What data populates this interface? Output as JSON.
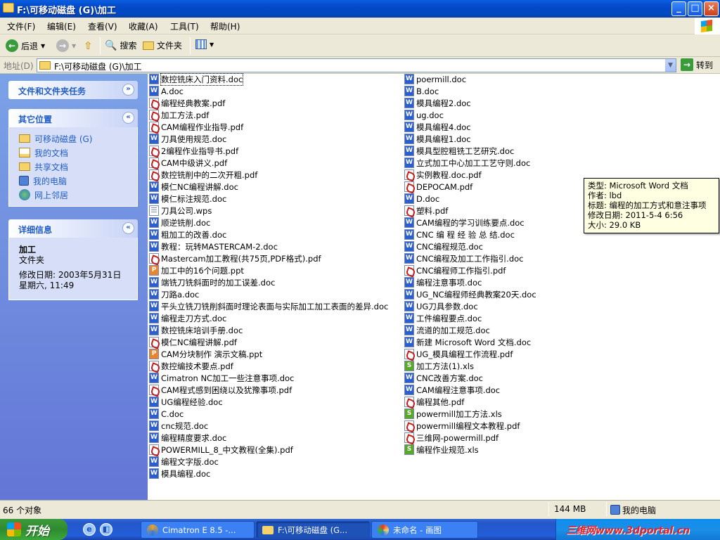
{
  "window": {
    "title": "F:\\可移动磁盘 (G)\\加工"
  },
  "menu": [
    "文件(F)",
    "编辑(E)",
    "查看(V)",
    "收藏(A)",
    "工具(T)",
    "帮助(H)"
  ],
  "toolbar": {
    "back": "后退",
    "search": "搜索",
    "folders": "文件夹"
  },
  "address": {
    "label": "地址(D)",
    "value": "F:\\可移动磁盘 (G)\\加工",
    "go": "转到"
  },
  "left": {
    "tasks_title": "文件和文件夹任务",
    "places_title": "其它位置",
    "places": [
      "可移动磁盘 (G)",
      "我的文档",
      "共享文档",
      "我的电脑",
      "网上邻居"
    ],
    "details_title": "详细信息",
    "details": {
      "name": "加工",
      "type": "文件夹",
      "modified_label": "修改日期:",
      "modified_date": "2003年5月31日",
      "modified_time": "星期六, 11:49"
    }
  },
  "files_col1": [
    {
      "name": "数控铣床入门资料.doc",
      "type": "doc"
    },
    {
      "name": "A.doc",
      "type": "doc"
    },
    {
      "name": "编程经典教案.pdf",
      "type": "pdf"
    },
    {
      "name": "加工方法.pdf",
      "type": "pdf"
    },
    {
      "name": "CAM编程作业指导.pdf",
      "type": "pdf"
    },
    {
      "name": "刀具使用规范.doc",
      "type": "doc"
    },
    {
      "name": "2编程作业指导书.pdf",
      "type": "pdf"
    },
    {
      "name": "CAM中级讲义.pdf",
      "type": "pdf"
    },
    {
      "name": "数控铣削中的二次开粗.pdf",
      "type": "pdf"
    },
    {
      "name": "模仁NC编程讲解.doc",
      "type": "doc"
    },
    {
      "name": "模仁标注规范.doc",
      "type": "doc"
    },
    {
      "name": "刀具公司.wps",
      "type": "wps"
    },
    {
      "name": "顺逆铣削.doc",
      "type": "doc"
    },
    {
      "name": "粗加工的改善.doc",
      "type": "doc"
    },
    {
      "name": "教程：玩转MASTERCAM-2.doc",
      "type": "doc"
    },
    {
      "name": "Mastercam加工教程(共75页,PDF格式).pdf",
      "type": "pdf"
    },
    {
      "name": "加工中的16个问题.ppt",
      "type": "ppt"
    },
    {
      "name": "端铣刀铣斜面时的加工误差.doc",
      "type": "doc"
    },
    {
      "name": "刀路a.doc",
      "type": "doc"
    },
    {
      "name": "平头立铣刀铣削斜面时理论表面与实际加工加工表面的差异.doc",
      "type": "doc"
    },
    {
      "name": "编程走刀方式.doc",
      "type": "doc"
    },
    {
      "name": "数控铣床培训手册.doc",
      "type": "doc"
    },
    {
      "name": "模仁NC编程讲解.pdf",
      "type": "pdf"
    },
    {
      "name": "CAM分块制作 演示文稿.ppt",
      "type": "ppt"
    },
    {
      "name": "数控编技术要点.pdf",
      "type": "pdf"
    },
    {
      "name": "Cimatron NC加工一些注意事项.doc",
      "type": "doc"
    },
    {
      "name": "CAM程式感到困绕以及犹豫事项.pdf",
      "type": "pdf"
    },
    {
      "name": "UG编程经验.doc",
      "type": "doc"
    },
    {
      "name": "C.doc",
      "type": "doc"
    },
    {
      "name": "cnc规范.doc",
      "type": "doc"
    },
    {
      "name": "编程精度要求.doc",
      "type": "doc"
    },
    {
      "name": "POWERMILL_8_中文教程(全集).pdf",
      "type": "pdf"
    },
    {
      "name": "编程文字版.doc",
      "type": "doc"
    },
    {
      "name": "模具编程.doc",
      "type": "doc"
    }
  ],
  "files_col2": [
    {
      "name": "poermill.doc",
      "type": "doc"
    },
    {
      "name": "B.doc",
      "type": "doc"
    },
    {
      "name": "模具编程2.doc",
      "type": "doc"
    },
    {
      "name": "ug.doc",
      "type": "doc"
    },
    {
      "name": "模具编程4.doc",
      "type": "doc"
    },
    {
      "name": "模具编程1.doc",
      "type": "doc"
    },
    {
      "name": "模具型腔粗铣工艺研究.doc",
      "type": "doc"
    },
    {
      "name": "立式加工中心加工工艺守则.doc",
      "type": "doc"
    },
    {
      "name": "实例教程.doc.pdf",
      "type": "pdf"
    },
    {
      "name": "DEPOCAM.pdf",
      "type": "pdf"
    },
    {
      "name": "D.doc",
      "type": "doc"
    },
    {
      "name": "塑料.pdf",
      "type": "pdf"
    },
    {
      "name": "CAM编程的学习训练要点.doc",
      "type": "doc"
    },
    {
      "name": "CNC 编 程 经 验 总 结.doc",
      "type": "doc"
    },
    {
      "name": "CNC编程规范.doc",
      "type": "doc"
    },
    {
      "name": "CNC编程及加工工作指引.doc",
      "type": "doc"
    },
    {
      "name": "CNC编程师工作指引.pdf",
      "type": "pdf"
    },
    {
      "name": "编程注意事项.doc",
      "type": "doc"
    },
    {
      "name": "UG_NC编程师经典教案20天.doc",
      "type": "doc"
    },
    {
      "name": "UG刀具参数.doc",
      "type": "doc"
    },
    {
      "name": "工件编程要点.doc",
      "type": "doc"
    },
    {
      "name": "流道的加工规范.doc",
      "type": "doc"
    },
    {
      "name": "新建 Microsoft Word 文档.doc",
      "type": "doc"
    },
    {
      "name": "UG_模具编程工作流程.pdf",
      "type": "pdf"
    },
    {
      "name": "加工方法(1).xls",
      "type": "xls"
    },
    {
      "name": "CNC改善方案.doc",
      "type": "doc"
    },
    {
      "name": "CAM编程注意事项.doc",
      "type": "doc"
    },
    {
      "name": "编程其他.pdf",
      "type": "pdf"
    },
    {
      "name": "powermill加工方法.xls",
      "type": "xls"
    },
    {
      "name": "powermill编程文本教程.pdf",
      "type": "pdf"
    },
    {
      "name": "三维网-powermill.pdf",
      "type": "pdf"
    },
    {
      "name": "编程作业规范.xls",
      "type": "xls"
    }
  ],
  "tooltip": {
    "type": "类型: Microsoft Word 文档",
    "author": "作者: lbd",
    "title": "标题: 编程的加工方式和意注事项",
    "modified": "修改日期: 2011-5-4 6:56",
    "size": "大小: 29.0 KB"
  },
  "status": {
    "count": "66 个对象",
    "size": "144 MB",
    "location": "我的电脑"
  },
  "taskbar": {
    "start": "开始",
    "tasks": [
      "Cimatron E 8.5 -...",
      "F:\\可移动磁盘 (G...",
      "未命名 - 画图"
    ],
    "watermark": "三维网www.3dportal.cn"
  }
}
